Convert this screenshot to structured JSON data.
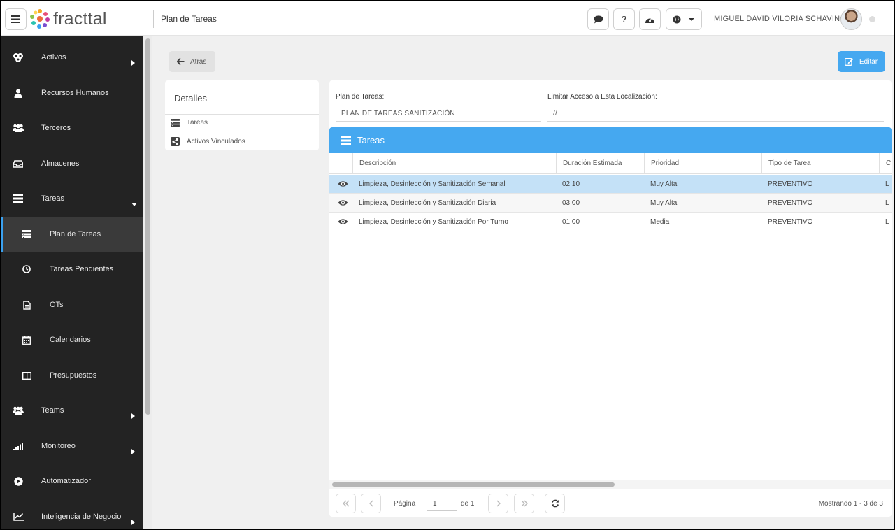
{
  "app": {
    "brand": "fracttal",
    "page_title": "Plan de Tareas"
  },
  "user": {
    "name": "MIGUEL DAVID VILORIA SCHAVINO"
  },
  "topbar": {
    "help_label": "?"
  },
  "sidebar": {
    "items": [
      {
        "label": "Activos",
        "icon": "assets-icon"
      },
      {
        "label": "Recursos Humanos",
        "icon": "user-icon"
      },
      {
        "label": "Terceros",
        "icon": "group-icon"
      },
      {
        "label": "Almacenes",
        "icon": "inbox-icon"
      },
      {
        "label": "Tareas",
        "icon": "tasks-icon"
      },
      {
        "label": "Plan de Tareas",
        "icon": "tasks-icon"
      },
      {
        "label": "Tareas Pendientes",
        "icon": "clock-icon"
      },
      {
        "label": "OTs",
        "icon": "document-icon"
      },
      {
        "label": "Calendarios",
        "icon": "calendar-icon"
      },
      {
        "label": "Presupuestos",
        "icon": "columns-icon"
      },
      {
        "label": "Teams",
        "icon": "group-icon"
      },
      {
        "label": "Monitoreo",
        "icon": "signal-icon"
      },
      {
        "label": "Automatizador",
        "icon": "play-icon"
      },
      {
        "label": "Inteligencia de Negocio",
        "icon": "chart-icon"
      }
    ]
  },
  "actions": {
    "back_label": "Atras",
    "edit_label": "Editar"
  },
  "details": {
    "title": "Detalles",
    "links": [
      {
        "label": "Tareas"
      },
      {
        "label": "Activos Vinculados"
      }
    ]
  },
  "form": {
    "plan_label": "Plan de Tareas:",
    "plan_value": "PLAN DE TAREAS SANITIZACIÓN",
    "access_label": "Limitar Acceso a Esta Localización:",
    "access_value": "//"
  },
  "tasks": {
    "title": "Tareas",
    "columns": [
      "Descripción",
      "Duración Estimada",
      "Prioridad",
      "Tipo de Tarea",
      "C"
    ],
    "rows": [
      {
        "description": "Limpieza, Desinfección y Sanitización Semanal",
        "duration": "02:10",
        "priority": "Muy Alta",
        "type": "PREVENTIVO",
        "extra": "L"
      },
      {
        "description": "Limpieza, Desinfección y Sanitización Diaria",
        "duration": "03:00",
        "priority": "Muy Alta",
        "type": "PREVENTIVO",
        "extra": "L"
      },
      {
        "description": "Limpieza, Desinfección y Sanitización Por Turno",
        "duration": "01:00",
        "priority": "Media",
        "type": "PREVENTIVO",
        "extra": "L"
      }
    ]
  },
  "pager": {
    "page_label": "Página",
    "page_value": "1",
    "of_label": "de 1",
    "showing": "Mostrando 1 - 3 de 3"
  },
  "colors": {
    "accent": "#45a8f0",
    "sidebar_bg": "#232323",
    "selected_row": "#c4e1f7"
  }
}
